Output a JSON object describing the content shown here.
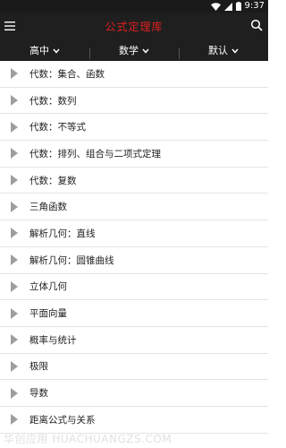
{
  "status_bar": {
    "time": "9:37"
  },
  "app_bar": {
    "title": "公式定理库"
  },
  "filters": [
    {
      "label": "高中"
    },
    {
      "label": "数学"
    },
    {
      "label": "默认"
    }
  ],
  "topics": [
    {
      "label": "代数：集合、函数"
    },
    {
      "label": "代数：数列"
    },
    {
      "label": "代数：不等式"
    },
    {
      "label": "代数：排列、组合与二项式定理"
    },
    {
      "label": "代数：复数"
    },
    {
      "label": "三角函数"
    },
    {
      "label": "解析几何：直线"
    },
    {
      "label": "解析几何：圆锥曲线"
    },
    {
      "label": "立体几何"
    },
    {
      "label": "平面向量"
    },
    {
      "label": "概率与统计"
    },
    {
      "label": "极限"
    },
    {
      "label": "导数"
    },
    {
      "label": "距离公式与关系"
    }
  ],
  "watermark": {
    "text": "华创应用 HUACHUANGZS.COM"
  },
  "colors": {
    "title": "#e0201f",
    "bar_bg": "#1f1f1f",
    "arrow": "#9e9e9e"
  }
}
